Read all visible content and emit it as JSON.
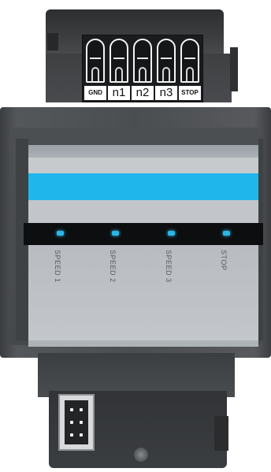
{
  "device": {
    "terminals": [
      {
        "label": "GND"
      },
      {
        "label": "n1"
      },
      {
        "label": "n2"
      },
      {
        "label": "n3"
      },
      {
        "label": "STOP"
      }
    ],
    "indicators": [
      {
        "label": "SPEED 1"
      },
      {
        "label": "SPEED 2"
      },
      {
        "label": "SPEED 3"
      },
      {
        "label": "STOP"
      }
    ]
  },
  "colors": {
    "accent_stripe": "#1fb6ec",
    "led": "#2bb7e6",
    "housing": "#4b4e51"
  }
}
